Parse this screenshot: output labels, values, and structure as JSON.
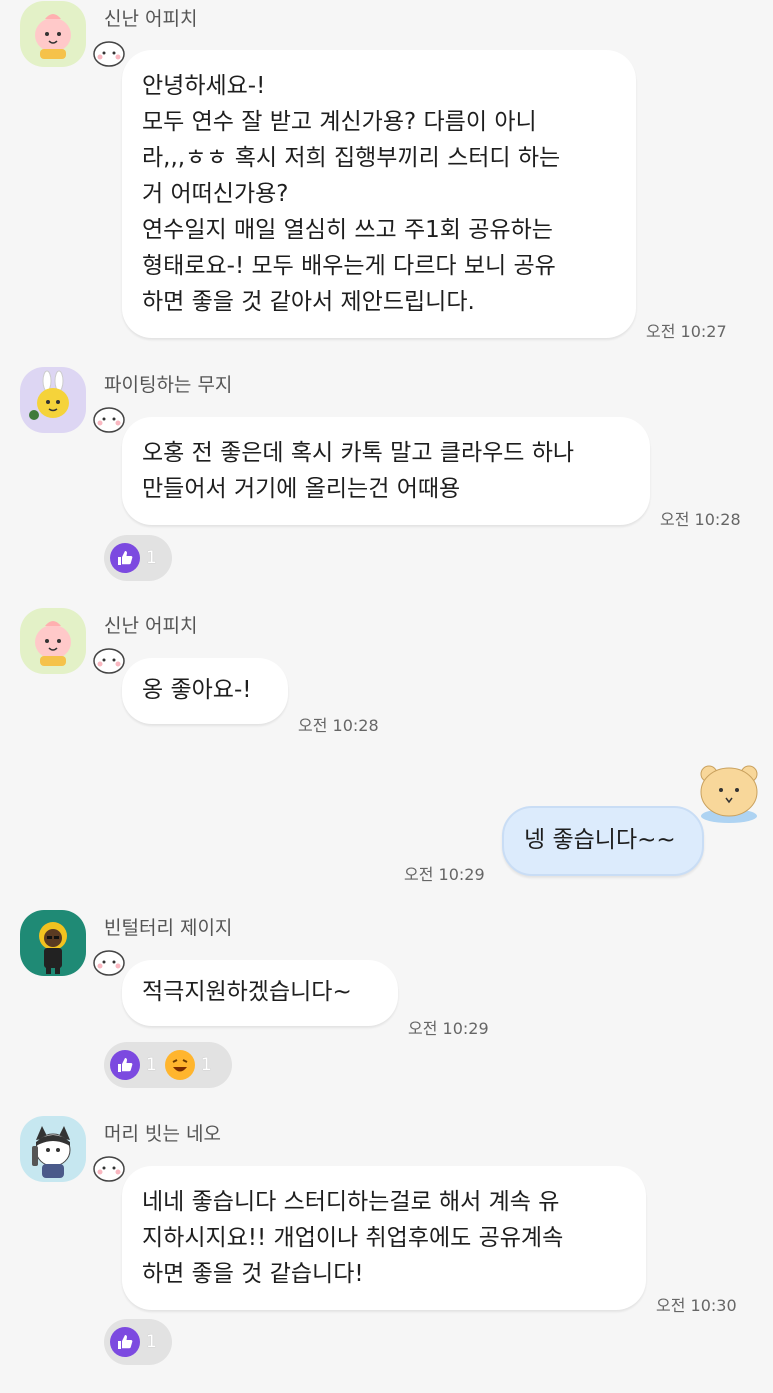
{
  "messages": [
    {
      "sender": "신난 어피치",
      "lines": [
        "안녕하세요-!",
        "모두 연수 잘 받고 계신가용? 다름이 아니",
        "라,,,ㅎㅎ 혹시 저희 집행부끼리 스터디 하는",
        "거 어떠신가용?",
        "연수일지 매일 열심히 쓰고 주1회 공유하는",
        "형태로요-! 모두 배우는게 다르다 보니 공유",
        "하면 좋을 것 같아서 제안드립니다."
      ],
      "time": "오전 10:27"
    },
    {
      "sender": "파이팅하는 무지",
      "lines": [
        "오홍 전 좋은데 혹시 카톡 말고 클라우드 하나",
        "만들어서 거기에 올리는건 어때용"
      ],
      "time": "오전 10:28",
      "reactions": {
        "like": "1"
      }
    },
    {
      "sender": "신난 어피치",
      "lines": [
        "옹 좋아요-!"
      ],
      "time": "오전 10:28"
    },
    {
      "sender": "me",
      "lines": [
        "넹 좋습니다~~"
      ],
      "time": "오전 10:29"
    },
    {
      "sender": "빈털터리 제이지",
      "lines": [
        "적극지원하겠습니다~"
      ],
      "time": "오전 10:29",
      "reactions": {
        "like": "1",
        "laugh": "1"
      }
    },
    {
      "sender": "머리 빗는 네오",
      "lines": [
        "네네 좋습니다 스터디하는걸로 해서 계속 유",
        "지하시지요!! 개업이나 취업후에도 공유계속",
        "하면 좋을 것 같습니다!"
      ],
      "time": "오전 10:30",
      "reactions": {
        "like": "1"
      }
    }
  ],
  "colors": {
    "background": "#f6f6f6",
    "bubble_other": "#ffffff",
    "bubble_me": "#dcebfc",
    "like_reaction": "#7c4ae0"
  },
  "icons": [
    "apeach-avatar",
    "muzi-avatar",
    "jay-g-avatar",
    "neo-avatar",
    "my-bear-avatar",
    "profile-sticker-icon",
    "like-thumb-icon",
    "laugh-emoji-icon"
  ]
}
